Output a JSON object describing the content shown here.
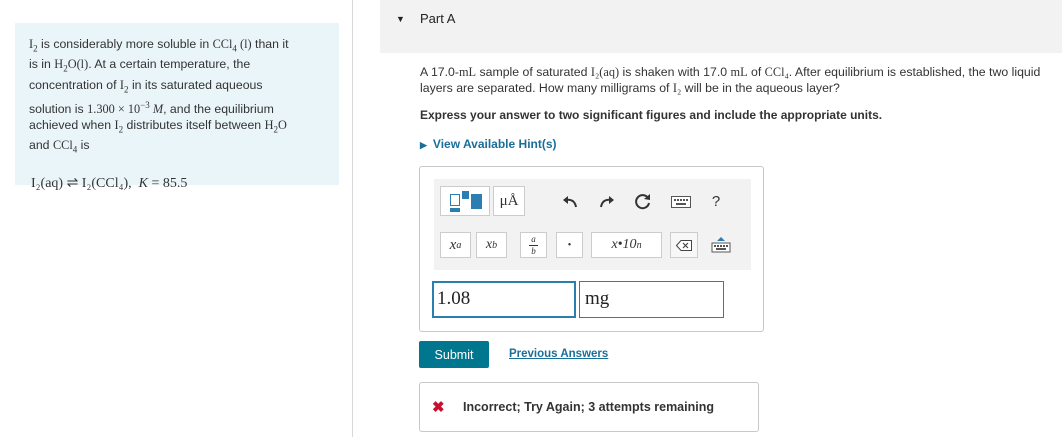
{
  "intro": {
    "line1a": "I",
    "line1sub": "2",
    "line1b": " is considerably more soluble in ",
    "ccl4": "CCl",
    "ccl4sub": "4",
    "l_phase": " (l)",
    "line1c": " than it",
    "line2a": "is in ",
    "h2o": "H",
    "h2osub": "2",
    "h2o_tail": "O(l)",
    "line2b": ".  At a certain temperature, the",
    "line3": "concentration of ",
    "line3b": " in its saturated aqueous",
    "line4a": "solution is ",
    "conc": "1.300 × 10",
    "conc_exp": "−3",
    "conc_unit": " M",
    "line4b": ", and the equilibrium",
    "line5a": "achieved when ",
    "line5b": " distributes itself between ",
    "line6a": "and ",
    "line6b": " is",
    "equation": "I₂(aq) ⇌ I₂(CCl₄),",
    "k_label": "K",
    "k_value": " = 85.5"
  },
  "part": {
    "label": "Part A"
  },
  "question": {
    "text_a": "A 17.0-",
    "ml": "mL",
    "text_b": " sample of saturated ",
    "i2aq": "I₂(aq)",
    "text_c": " is shaken with 17.0 ",
    "text_d": " of ",
    "ccl4": "CCl₄",
    "text_e": ". After equilibrium is established, the two liquid layers are separated. How many milligrams of ",
    "i2": "I₂",
    "text_f": " will be in the aqueous layer?"
  },
  "instruction": "Express your answer to two significant figures and include the appropriate units.",
  "hints_label": "View Available Hint(s)",
  "toolbar": {
    "units_label": "μÅ",
    "help_label": "?",
    "xa_label": "x",
    "xa_sup": "a",
    "xb_label": "x",
    "xb_sub": "b",
    "frac_num": "a",
    "frac_den": "b",
    "dot_label": "•",
    "sci_label": "x•10",
    "sci_sup": "n"
  },
  "answer": {
    "value": "1.08",
    "units": "mg"
  },
  "submit_label": "Submit",
  "previous_answers_label": "Previous Answers",
  "feedback": {
    "icon": "✖",
    "text": "Incorrect; Try Again; 3 attempts remaining"
  }
}
